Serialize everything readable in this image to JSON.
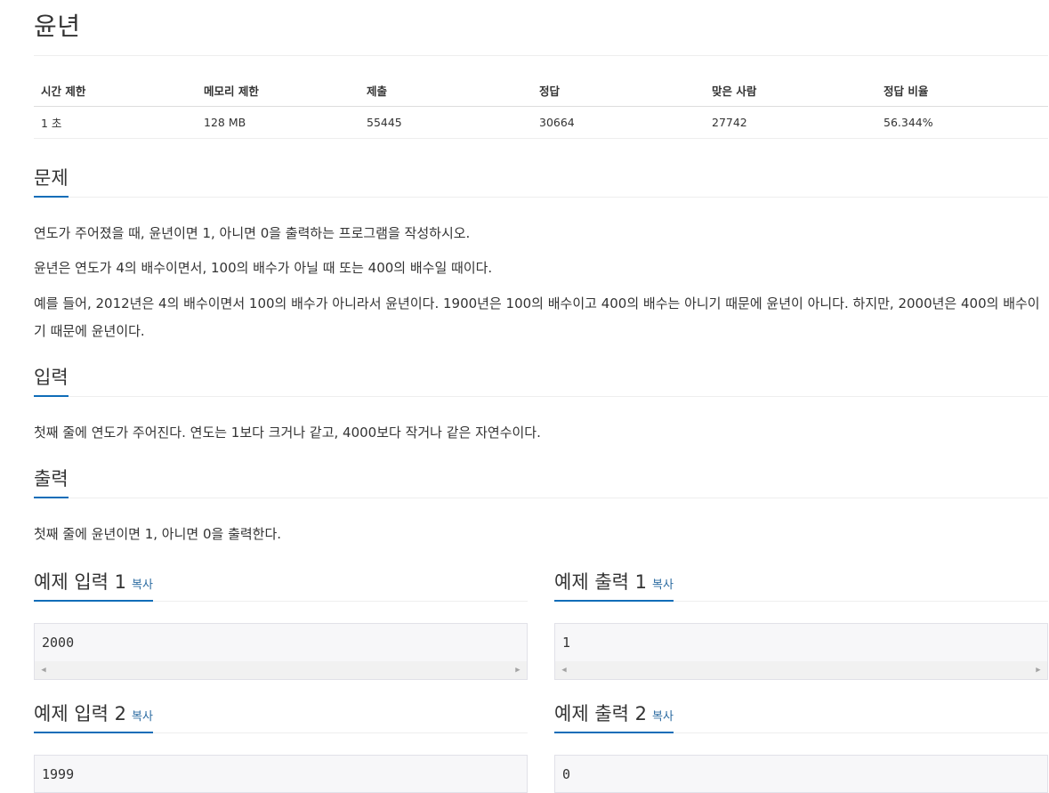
{
  "problem": {
    "title": "윤년"
  },
  "info": {
    "headers": [
      "시간 제한",
      "메모리 제한",
      "제출",
      "정답",
      "맞은 사람",
      "정답 비율"
    ],
    "values": [
      "1 초",
      "128 MB",
      "55445",
      "30664",
      "27742",
      "56.344%"
    ]
  },
  "sections": {
    "problem_label": "문제",
    "problem_paragraphs": [
      "연도가 주어졌을 때, 윤년이면 1, 아니면 0을 출력하는 프로그램을 작성하시오.",
      "윤년은 연도가 4의 배수이면서, 100의 배수가 아닐 때 또는 400의 배수일 때이다.",
      "예를 들어, 2012년은 4의 배수이면서 100의 배수가 아니라서 윤년이다. 1900년은 100의 배수이고 400의 배수는 아니기 때문에 윤년이 아니다. 하지만, 2000년은 400의 배수이기 때문에 윤년이다."
    ],
    "input_label": "입력",
    "input_text": "첫째 줄에 연도가 주어진다. 연도는 1보다 크거나 같고, 4000보다 작거나 같은 자연수이다.",
    "output_label": "출력",
    "output_text": "첫째 줄에 윤년이면 1, 아니면 0을 출력한다."
  },
  "samples": {
    "copy_label": "복사",
    "in1_label": "예제 입력 1",
    "in1_value": "2000",
    "out1_label": "예제 출력 1",
    "out1_value": "1",
    "in2_label": "예제 입력 2",
    "in2_value": "1999",
    "out2_label": "예제 출력 2",
    "out2_value": "0"
  },
  "icons": {
    "scroll_left": "◀",
    "scroll_right": "▶"
  },
  "colors": {
    "accent": "#0f6db8",
    "link": "#2d6ca2",
    "sample_bg": "#f7f7f9"
  }
}
